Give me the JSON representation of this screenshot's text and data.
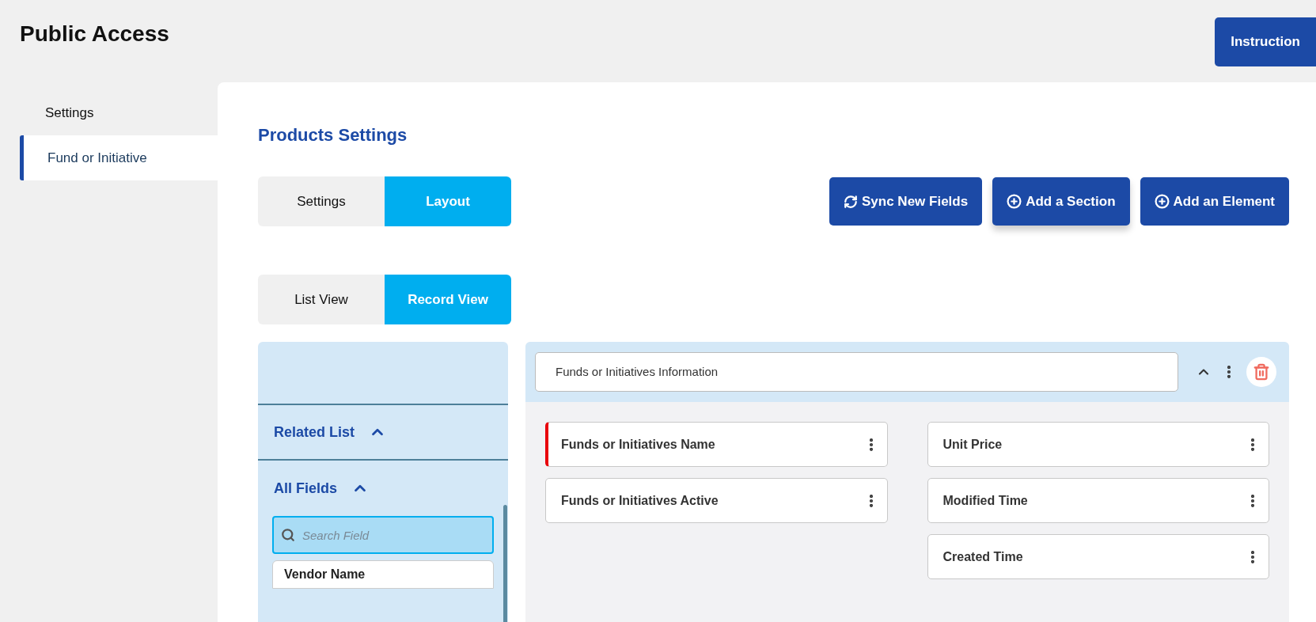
{
  "page_title": "Public Access",
  "instruction_button": "Instruction",
  "sidebar": {
    "items": [
      {
        "label": "Settings",
        "selected": false
      },
      {
        "label": "Fund or Initiative",
        "selected": true
      }
    ]
  },
  "main": {
    "title": "Products Settings",
    "tabs": [
      {
        "label": "Settings",
        "selected": false
      },
      {
        "label": "Layout",
        "selected": true
      }
    ],
    "actions": [
      {
        "label": "Sync New Fields",
        "kind": "sync"
      },
      {
        "label": "Add a Section",
        "kind": "add"
      },
      {
        "label": "Add an Element",
        "kind": "add"
      }
    ],
    "view_toggle": [
      {
        "label": "List View",
        "selected": false
      },
      {
        "label": "Record View",
        "selected": true
      }
    ],
    "field_panel": {
      "groups": [
        {
          "label": "Related List",
          "expanded": true
        },
        {
          "label": "All Fields",
          "expanded": true
        }
      ],
      "search": {
        "placeholder": "Search Field"
      },
      "fields": [
        "Vendor Name"
      ]
    },
    "section": {
      "title": "Funds or Initiatives Information",
      "expanded": true,
      "columns": [
        [
          {
            "label": "Funds or Initiatives Name",
            "required": true
          },
          {
            "label": "Funds or Initiatives Active",
            "required": false
          }
        ],
        [
          {
            "label": "Unit Price",
            "required": false
          },
          {
            "label": "Modified Time",
            "required": false
          },
          {
            "label": "Created Time",
            "required": false
          }
        ]
      ]
    }
  }
}
